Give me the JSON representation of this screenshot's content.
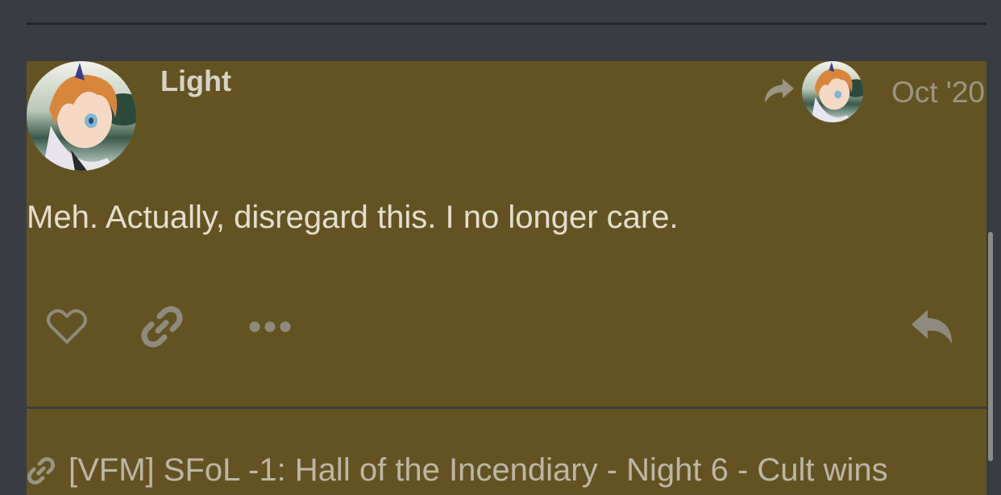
{
  "post": {
    "username": "Light",
    "date": "Oct '20",
    "body": "Meh. Actually, disregard this. I no longer care.",
    "avatar_icon": "user-avatar",
    "reply_to_icon": "reply-arrow-icon"
  },
  "actions": {
    "like_icon": "heart-icon",
    "link_icon": "link-icon",
    "more_icon": "ellipsis-icon",
    "reply_icon": "reply-icon"
  },
  "linked_topic": {
    "title": "[VFM] SFoL -1: Hall of the Incendiary - Night 6 - Cult wins"
  },
  "colors": {
    "page_bg": "#393c42",
    "post_bg": "#645322",
    "text": "#e3ded0",
    "muted": "#9a9585"
  }
}
